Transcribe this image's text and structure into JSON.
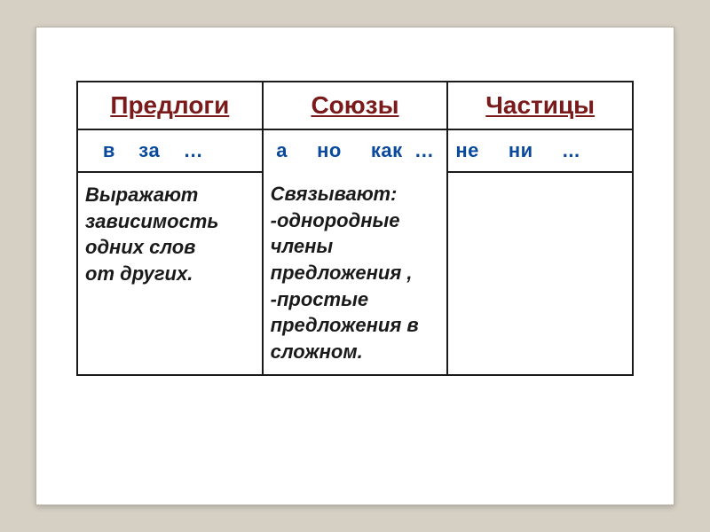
{
  "table": {
    "headers": {
      "prepositions": "Предлоги",
      "conjunctions": "Союзы",
      "particles": "Частицы"
    },
    "examples": {
      "prepositions": "   в    за    …",
      "conjunctions": " а     но     как  …",
      "particles": "не     ни     ..."
    },
    "descriptions": {
      "prepositions": "Выражают зависимость одних слов\n от других.",
      "conjunctions": "Связывают:\n-однородные члены предложения ,\n-простые предложения в сложном.",
      "particles": ""
    }
  }
}
